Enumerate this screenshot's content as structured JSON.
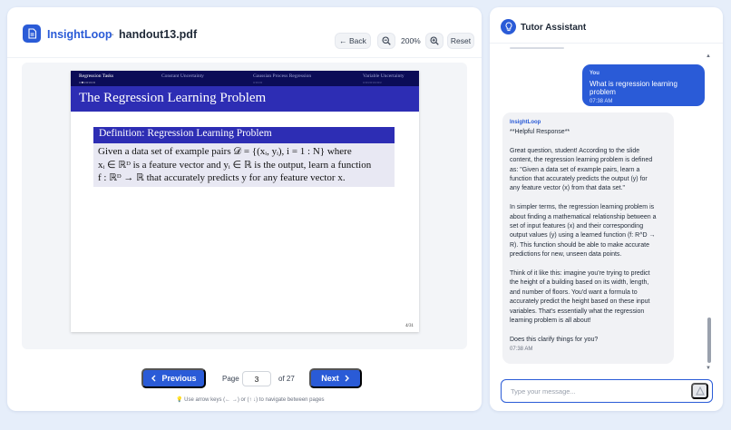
{
  "header": {
    "brand": "InsightLoop",
    "separator": "·",
    "filename": "handout13.pdf",
    "back_label": "← Back",
    "zoom_level": "200%",
    "reset_label": "Reset"
  },
  "slide": {
    "nav": [
      "Regression Tasks",
      "Constant Uncertainty",
      "Gaussian Process Regression",
      "Variable Uncertainty"
    ],
    "title": "The Regression Learning Problem",
    "definition_title": "Definition: Regression Learning Problem",
    "definition_lines": [
      "Given a data set of example pairs 𝒟 = {(xᵢ, yᵢ), i = 1 : N} where",
      "xᵢ ∈ ℝᴰ is a feature vector and yᵢ ∈ ℝ is the output, learn a function",
      "f : ℝᴰ → ℝ that accurately predicts y for any feature vector x."
    ],
    "page_indicator": "4/31"
  },
  "pager": {
    "prev_label": "Previous",
    "page_label": "Page",
    "current_page": "3",
    "total_label": "of 27",
    "next_label": "Next",
    "hint": "💡 Use arrow keys (← →) or (↑ ↓) to navigate between pages"
  },
  "tutor": {
    "title": "Tutor Assistant",
    "user_message": {
      "name": "You",
      "text": "What is regression learning problem",
      "time": "07:38 AM"
    },
    "ai_message": {
      "name": "InsightLoop",
      "lines": [
        "**Helpful Response**",
        "",
        "Great question, student! According to the slide",
        "content, the regression learning problem is defined",
        "as: \"Given a data set of example pairs, learn a",
        "function that accurately predicts the output (y) for",
        "any feature vector (x) from that data set.\"",
        "",
        "In simpler terms, the regression learning problem is",
        "about finding a mathematical relationship between a",
        "set of input features (x) and their corresponding",
        "output values (y) using a learned function (f: R^D →",
        "R). This function should be able to make accurate",
        "predictions for new, unseen data points.",
        "",
        "Think of it like this: imagine you're trying to predict",
        "the height of a building based on its width, length,",
        "and number of floors. You'd want a formula to",
        "accurately predict the height based on these input",
        "variables. That's essentially what the regression",
        "learning problem is all about!",
        "",
        "Does this clarify things for you?"
      ],
      "time": "07:38 AM"
    },
    "input_placeholder": "Type your message..."
  }
}
